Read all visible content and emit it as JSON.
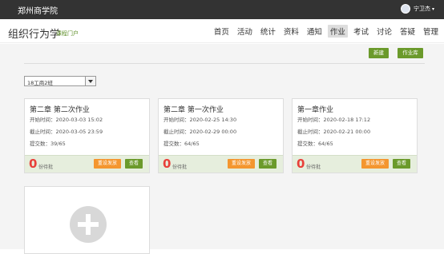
{
  "topbar": {
    "school": "郑州商学院",
    "username": "宁卫杰"
  },
  "header": {
    "brand": "组织行为学",
    "portal": "课程门户",
    "nav": [
      {
        "label": "首页"
      },
      {
        "label": "活动"
      },
      {
        "label": "统计"
      },
      {
        "label": "资料"
      },
      {
        "label": "通知"
      },
      {
        "label": "作业",
        "active": true
      },
      {
        "label": "考试"
      },
      {
        "label": "讨论"
      },
      {
        "label": "答疑"
      },
      {
        "label": "管理"
      }
    ]
  },
  "toolbar": {
    "new_label": "新建",
    "library_label": "作业库"
  },
  "class_select": {
    "value": "18工商2班"
  },
  "cards": [
    {
      "title": "第二章 第二次作业",
      "start_label": "开始时间",
      "start_time": "2020-03-03 15:02",
      "end_label": "截止时间",
      "end_time": "2020-03-05 23:59",
      "submit_label": "提交数",
      "submit_count": "39/65",
      "pending_count": "0",
      "pending_label": "份待批",
      "redo_label": "重设发放",
      "view_label": "查看"
    },
    {
      "title": "第二章 第一次作业",
      "start_label": "开始时间",
      "start_time": "2020-02-25 14:30",
      "end_label": "截止时间",
      "end_time": "2020-02-29 00:00",
      "submit_label": "提交数",
      "submit_count": "64/65",
      "pending_count": "0",
      "pending_label": "份待批",
      "redo_label": "重设发放",
      "view_label": "查看"
    },
    {
      "title": "第一章作业",
      "start_label": "开始时间",
      "start_time": "2020-02-18 17:12",
      "end_label": "截止时间",
      "end_time": "2020-02-21 00:00",
      "submit_label": "提交数",
      "submit_count": "64/65",
      "pending_count": "0",
      "pending_label": "份待批",
      "redo_label": "重设发放",
      "view_label": "查看"
    }
  ],
  "icons": {
    "add": "plus-icon",
    "avatar": "user-avatar",
    "dropdown": "chevron-down-icon"
  },
  "colors": {
    "topbar": "#333333",
    "accent_green": "#6b9a2b",
    "orange": "#f4962f",
    "zero_red": "#e8403a"
  }
}
